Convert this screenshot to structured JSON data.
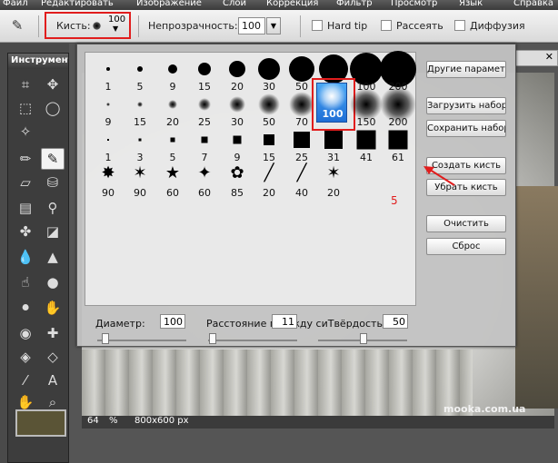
{
  "menu": {
    "items": [
      "Файл",
      "Редактировать",
      "Изображение",
      "Слой",
      "Коррекция",
      "Фильтр",
      "Просмотр",
      "Язык",
      "Справка"
    ]
  },
  "toolbar": {
    "brush_label": "Кисть:",
    "brush_size": "100",
    "opacity_label": "Непрозрачность:",
    "opacity_value": "100",
    "hard_tip_label": "Hard tip",
    "scatter_label": "Рассеять",
    "diffusion_label": "Диффузия"
  },
  "tools_panel": {
    "title": "Инструмент"
  },
  "brush_dialog": {
    "rows": [
      [
        "1",
        "5",
        "9",
        "15",
        "20",
        "30",
        "50",
        "70",
        "100",
        "200"
      ],
      [
        "9",
        "15",
        "20",
        "25",
        "30",
        "50",
        "70",
        "100",
        "150",
        "200"
      ],
      [
        "1",
        "3",
        "5",
        "7",
        "9",
        "15",
        "25",
        "31",
        "41",
        "61"
      ],
      [
        "90",
        "90",
        "60",
        "60",
        "85",
        "20",
        "40",
        "20"
      ]
    ],
    "selected": "100",
    "buttons": {
      "other_params": "Другие параметр",
      "load_set": "Загрузить набор",
      "save_set": "Сохранить набор",
      "create_brush": "Создать кисть",
      "remove_brush": "Убрать кисть",
      "clear": "Очистить",
      "reset": "Сброс"
    },
    "sliders": {
      "diameter_label": "Диаметр:",
      "diameter_value": "100",
      "spacing_label": "Расстояние м",
      "spacing_value": "11",
      "hardness_overlap": "жду сиТвёрдость:",
      "hardness_value": "50"
    }
  },
  "status": {
    "zoom": "64",
    "zoom_unit": "%",
    "size": "800x600 px"
  },
  "watermark": "mooka.com.ua",
  "annotation": "5",
  "colors": {
    "highlight": "#e11d1d",
    "selected_brush": "#2f86e6",
    "foreground_swatch": "#5a5436"
  }
}
